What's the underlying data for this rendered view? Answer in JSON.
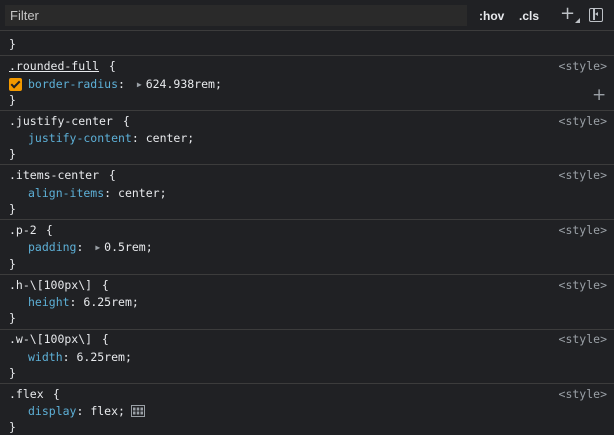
{
  "toolbar": {
    "filter_placeholder": "Filter",
    "hov_label": ":hov",
    "cls_label": ".cls",
    "add_rule_symbol": "+"
  },
  "top_close_brace": "}",
  "rules": [
    {
      "selector": ".rounded-full",
      "open": " {",
      "source": "<style>",
      "close": "}",
      "prop": "border-radius",
      "colon": ": ",
      "value": "624.938rem;"
    },
    {
      "selector": ".justify-center",
      "open": " {",
      "source": "<style>",
      "close": "}",
      "prop": "justify-content",
      "colon": ": ",
      "value": "center;"
    },
    {
      "selector": ".items-center",
      "open": " {",
      "source": "<style>",
      "close": "}",
      "prop": "align-items",
      "colon": ": ",
      "value": "center;"
    },
    {
      "selector": ".p-2",
      "open": " {",
      "source": "<style>",
      "close": "}",
      "prop": "padding",
      "colon": ": ",
      "value": "0.5rem;"
    },
    {
      "selector": ".h-\\[100px\\]",
      "open": " {",
      "source": "<style>",
      "close": "}",
      "prop": "height",
      "colon": ": ",
      "value": "6.25rem;"
    },
    {
      "selector": ".w-\\[100px\\]",
      "open": " {",
      "source": "<style>",
      "close": "}",
      "prop": "width",
      "colon": ": ",
      "value": "6.25rem;"
    },
    {
      "selector": ".flex",
      "open": " {",
      "source": "<style>",
      "close": "}",
      "prop": "display",
      "colon": ": ",
      "value": "flex;"
    }
  ],
  "add_declaration_symbol": "+",
  "colors": {
    "background": "#202124",
    "property_name": "#5db0d7",
    "checkbox": "#f29900",
    "divider": "#3c3c3c"
  }
}
